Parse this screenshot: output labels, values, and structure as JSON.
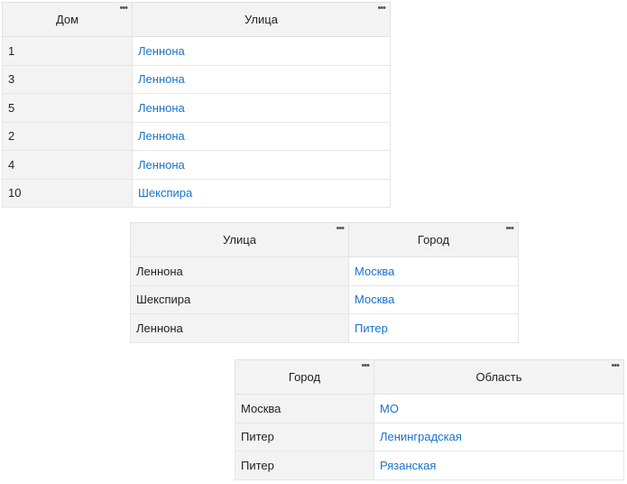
{
  "tables": [
    {
      "headers": [
        "Дом",
        "Улица"
      ],
      "menu_glyph": "•••",
      "rows": [
        [
          "1",
          "Леннона"
        ],
        [
          "3",
          "Леннона"
        ],
        [
          "5",
          "Леннона"
        ],
        [
          "2",
          "Леннона"
        ],
        [
          "4",
          "Леннона"
        ],
        [
          "10",
          "Шекспира"
        ]
      ]
    },
    {
      "headers": [
        "Улица",
        "Город"
      ],
      "menu_glyph": "•••",
      "rows": [
        [
          "Леннона",
          "Москва"
        ],
        [
          "Шекспира",
          "Москва"
        ],
        [
          "Леннона",
          "Питер"
        ]
      ]
    },
    {
      "headers": [
        "Город",
        "Область"
      ],
      "menu_glyph": "•••",
      "rows": [
        [
          "Москва",
          "МО"
        ],
        [
          "Питер",
          "Ленинградская"
        ],
        [
          "Питер",
          "Рязанская"
        ]
      ]
    }
  ],
  "colors": {
    "link": "#1a73c8",
    "header_bg": "#f3f3f3",
    "border": "#e2e2e2"
  }
}
